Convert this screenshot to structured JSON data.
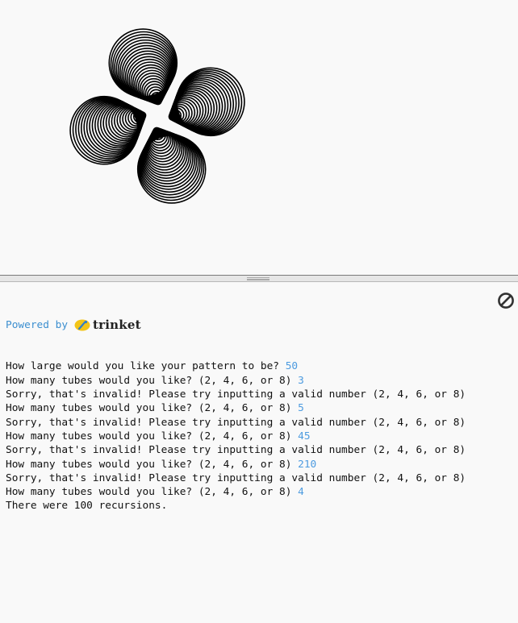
{
  "branding": {
    "powered_by": "Powered by",
    "logo_icon": "trinket-logo-icon",
    "brand_name": "trinket"
  },
  "toolbar": {
    "clear_icon": "no-entry-icon"
  },
  "canvas": {
    "drawing": "turtle-tubes-pattern",
    "tubes": 4
  },
  "console": {
    "lines": [
      {
        "prompt": "How large would you like your pattern to be? ",
        "input": "50"
      },
      {
        "prompt": "How many tubes would you like? (2, 4, 6, or 8) ",
        "input": "3"
      },
      {
        "prompt": "Sorry, that's invalid! Please try inputting a valid number (2, 4, 6, or 8)",
        "input": ""
      },
      {
        "prompt": "How many tubes would you like? (2, 4, 6, or 8) ",
        "input": "5"
      },
      {
        "prompt": "Sorry, that's invalid! Please try inputting a valid number (2, 4, 6, or 8)",
        "input": ""
      },
      {
        "prompt": "How many tubes would you like? (2, 4, 6, or 8) ",
        "input": "45"
      },
      {
        "prompt": "Sorry, that's invalid! Please try inputting a valid number (2, 4, 6, or 8)",
        "input": ""
      },
      {
        "prompt": "How many tubes would you like? (2, 4, 6, or 8) ",
        "input": "210"
      },
      {
        "prompt": "Sorry, that's invalid! Please try inputting a valid number (2, 4, 6, or 8)",
        "input": ""
      },
      {
        "prompt": "How many tubes would you like? (2, 4, 6, or 8) ",
        "input": "4"
      },
      {
        "prompt": "There were 100 recursions.",
        "input": ""
      }
    ]
  },
  "colors": {
    "background": "#f9f9f9",
    "input_text": "#4d9be0",
    "powered_text": "#3c8fd0",
    "pen": "#000000"
  }
}
